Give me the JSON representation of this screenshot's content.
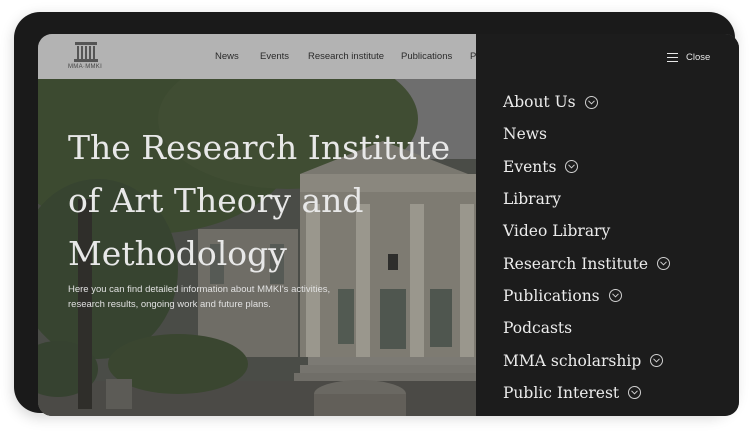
{
  "site": {
    "logo_text": "MMA·MMKI"
  },
  "header": {
    "nav": [
      "News",
      "Events",
      "Research institute",
      "Publications",
      "P"
    ]
  },
  "hero": {
    "title_lines": [
      "The Research Institute",
      "of Art Theory and",
      "Methodology"
    ],
    "subtitle_lines": [
      "Here you can find detailed information about MMKI's activities,",
      "research results, ongoing work and future plans."
    ]
  },
  "menu": {
    "close_label": "Close",
    "items": [
      {
        "label": "About Us",
        "expandable": true
      },
      {
        "label": "News",
        "expandable": false
      },
      {
        "label": "Events",
        "expandable": true
      },
      {
        "label": "Library",
        "expandable": false
      },
      {
        "label": "Video Library",
        "expandable": false
      },
      {
        "label": "Research Institute",
        "expandable": true
      },
      {
        "label": "Publications",
        "expandable": true
      },
      {
        "label": "Podcasts",
        "expandable": false
      },
      {
        "label": "MMA scholarship",
        "expandable": true
      },
      {
        "label": "Public Interest",
        "expandable": true
      }
    ]
  },
  "colors": {
    "menu_bg": "#1c1c1c",
    "header_bg": "#b3b3b3",
    "text_light": "#ececec"
  }
}
